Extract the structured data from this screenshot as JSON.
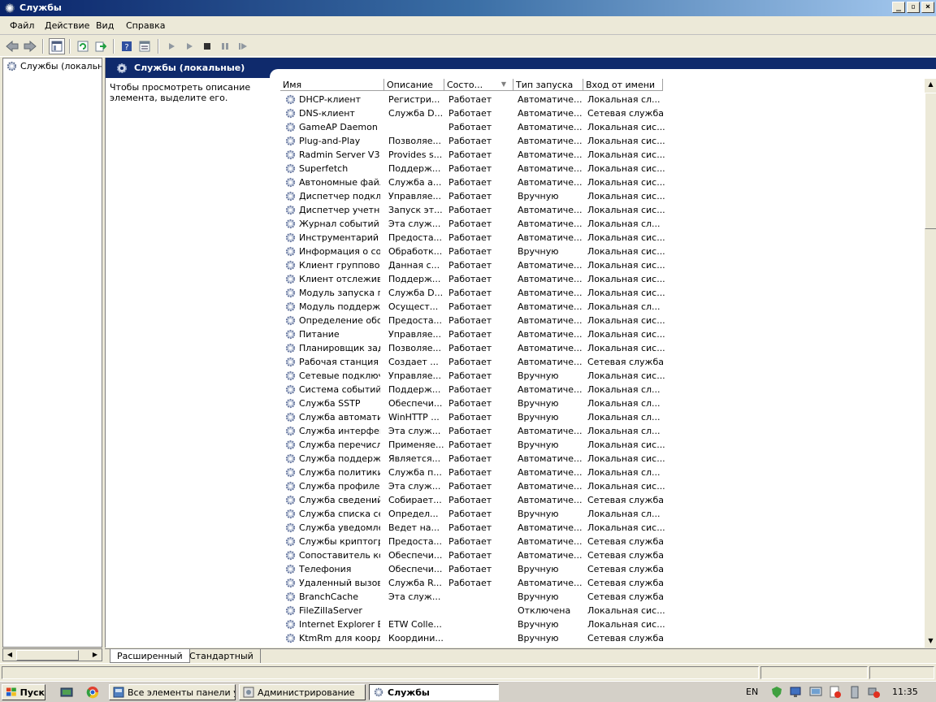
{
  "window": {
    "title": "Службы"
  },
  "menu": [
    "Файл",
    "Действие",
    "Вид",
    "Справка"
  ],
  "tree": {
    "root": "Службы (локальные"
  },
  "panel": {
    "header": "Службы (локальные)",
    "description": "Чтобы просмотреть описание элемента, выделите его."
  },
  "columns": [
    "Имя",
    "Описание",
    "Состо...",
    "Тип запуска",
    "Вход от имени"
  ],
  "services": [
    [
      "DHCP-клиент",
      "Регистри...",
      "Работает",
      "Автоматиче...",
      "Локальная сл..."
    ],
    [
      "DNS-клиент",
      "Служба D...",
      "Работает",
      "Автоматиче...",
      "Сетевая служба"
    ],
    [
      "GameAP Daemon",
      "",
      "Работает",
      "Автоматиче...",
      "Локальная сис..."
    ],
    [
      "Plug-and-Play",
      "Позволяе...",
      "Работает",
      "Автоматиче...",
      "Локальная сис..."
    ],
    [
      "Radmin Server V3",
      "Provides s...",
      "Работает",
      "Автоматиче...",
      "Локальная сис..."
    ],
    [
      "Superfetch",
      "Поддерж...",
      "Работает",
      "Автоматиче...",
      "Локальная сис..."
    ],
    [
      "Автономные файлы",
      "Служба а...",
      "Работает",
      "Автоматиче...",
      "Локальная сис..."
    ],
    [
      "Диспетчер подкл...",
      "Управляе...",
      "Работает",
      "Вручную",
      "Локальная сис..."
    ],
    [
      "Диспетчер учетн...",
      "Запуск эт...",
      "Работает",
      "Автоматиче...",
      "Локальная сис..."
    ],
    [
      "Журнал событий ...",
      "Эта служ...",
      "Работает",
      "Автоматиче...",
      "Локальная сл..."
    ],
    [
      "Инструментарий у...",
      "Предоста...",
      "Работает",
      "Автоматиче...",
      "Локальная сис..."
    ],
    [
      "Информация о сов...",
      "Обработк...",
      "Работает",
      "Вручную",
      "Локальная сис..."
    ],
    [
      "Клиент групповой...",
      "Данная с...",
      "Работает",
      "Автоматиче...",
      "Локальная сис..."
    ],
    [
      "Клиент отслежив...",
      "Поддерж...",
      "Работает",
      "Автоматиче...",
      "Локальная сис..."
    ],
    [
      "Модуль запуска п...",
      "Служба D...",
      "Работает",
      "Автоматиче...",
      "Локальная сис..."
    ],
    [
      "Модуль поддержк...",
      "Осущест...",
      "Работает",
      "Автоматиче...",
      "Локальная сл..."
    ],
    [
      "Определение обо...",
      "Предоста...",
      "Работает",
      "Автоматиче...",
      "Локальная сис..."
    ],
    [
      "Питание",
      "Управляе...",
      "Работает",
      "Автоматиче...",
      "Локальная сис..."
    ],
    [
      "Планировщик зад...",
      "Позволяе...",
      "Работает",
      "Автоматиче...",
      "Локальная сис..."
    ],
    [
      "Рабочая станция",
      "Создает ...",
      "Работает",
      "Автоматиче...",
      "Сетевая служба"
    ],
    [
      "Сетевые подключ...",
      "Управляе...",
      "Работает",
      "Вручную",
      "Локальная сис..."
    ],
    [
      "Система событий ...",
      "Поддерж...",
      "Работает",
      "Автоматиче...",
      "Локальная сл..."
    ],
    [
      "Служба SSTP",
      "Обеспечи...",
      "Работает",
      "Вручную",
      "Локальная сл..."
    ],
    [
      "Служба автомати...",
      "WinHTTP ...",
      "Работает",
      "Вручную",
      "Локальная сл..."
    ],
    [
      "Служба интерфей...",
      "Эта служ...",
      "Работает",
      "Автоматиче...",
      "Локальная сл..."
    ],
    [
      "Служба перечисл...",
      "Применяе...",
      "Работает",
      "Вручную",
      "Локальная сис..."
    ],
    [
      "Служба поддержк...",
      "Является...",
      "Работает",
      "Автоматиче...",
      "Локальная сис..."
    ],
    [
      "Служба политики ...",
      "Служба п...",
      "Работает",
      "Автоматиче...",
      "Локальная сл..."
    ],
    [
      "Служба профилей...",
      "Эта служ...",
      "Работает",
      "Автоматиче...",
      "Локальная сис..."
    ],
    [
      "Служба сведений ...",
      "Собирает...",
      "Работает",
      "Автоматиче...",
      "Сетевая служба"
    ],
    [
      "Служба списка се...",
      "Определ...",
      "Работает",
      "Вручную",
      "Локальная сл..."
    ],
    [
      "Служба уведомле...",
      "Ведет на...",
      "Работает",
      "Автоматиче...",
      "Локальная сис..."
    ],
    [
      "Службы криптогр...",
      "Предоста...",
      "Работает",
      "Автоматиче...",
      "Сетевая служба"
    ],
    [
      "Сопоставитель ко...",
      "Обеспечи...",
      "Работает",
      "Автоматиче...",
      "Сетевая служба"
    ],
    [
      "Телефония",
      "Обеспечи...",
      "Работает",
      "Вручную",
      "Сетевая служба"
    ],
    [
      "Удаленный вызов...",
      "Служба R...",
      "Работает",
      "Автоматиче...",
      "Сетевая служба"
    ],
    [
      "BranchCache",
      "Эта служ...",
      "",
      "Вручную",
      "Сетевая служба"
    ],
    [
      "FileZillaServer",
      "",
      "",
      "Отключена",
      "Локальная сис..."
    ],
    [
      "Internet Explorer E...",
      "ETW Colle...",
      "",
      "Вручную",
      "Локальная сис..."
    ],
    [
      "KtmRm для коорд...",
      "Координи...",
      "",
      "Вручную",
      "Сетевая служба"
    ]
  ],
  "tabs": [
    "Расширенный",
    "Стандартный"
  ],
  "taskbar": {
    "start": "Пуск",
    "apps": [
      "Все элементы панели у...",
      "Администрирование",
      "Службы"
    ],
    "lang": "EN",
    "clock": "11:35"
  }
}
